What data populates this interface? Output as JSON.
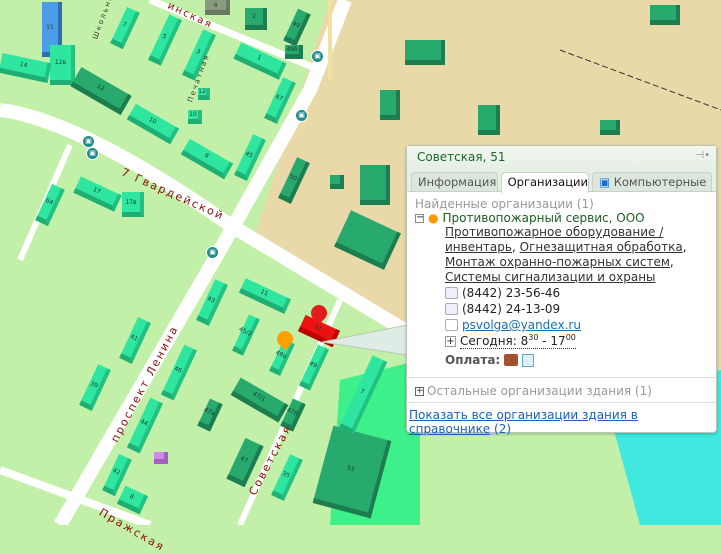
{
  "map": {
    "streets": {
      "gvard": "7 Гвардейской",
      "lenina": "проспект Ленина",
      "sovetskaya": "Советская",
      "prazh": "Пражская",
      "shkol": "Школьная",
      "pechat": "Печатная",
      "top": "инская"
    },
    "buildings": [
      "11",
      "12в",
      "14",
      "12",
      "7",
      "5",
      "3",
      "1",
      "4",
      "2",
      "49",
      "49б",
      "47",
      "45",
      "10",
      "8",
      "17",
      "17в",
      "64",
      "50",
      "43",
      "41",
      "46",
      "44",
      "42",
      "39",
      "8",
      "11",
      "45/2",
      "49а",
      "49",
      "47/1",
      "47б",
      "47а",
      "47",
      "35",
      "55",
      "7",
      "51",
      "12",
      "10"
    ]
  },
  "popup": {
    "title": "Советская, 51",
    "tabs": [
      "Информация",
      "Организации",
      "Компьютерные ..."
    ],
    "found_label": "Найденные организации (1)",
    "org_name": "Противопожарный сервис, ООО",
    "categories": [
      "Противопожарное оборудование / инвентарь",
      ",",
      "Огнезащитная обработка",
      ",",
      "Монтаж охранно-пожарных систем",
      ",",
      "Системы сигнализации и охраны"
    ],
    "fax": "(8442) 23-56-46",
    "phone": "(8442) 24-13-09",
    "email": "psvolga@yandex.ru",
    "hours_prefix": "Сегодня: 8",
    "hours_open_min": "30",
    "hours_sep": " - 17",
    "hours_close_min": "00",
    "payment_label": "Оплата:",
    "other_orgs": "Остальные организации здания (1)",
    "show_all_link": "Показать все организации здания в справочнике",
    "show_all_count": "(2)"
  }
}
